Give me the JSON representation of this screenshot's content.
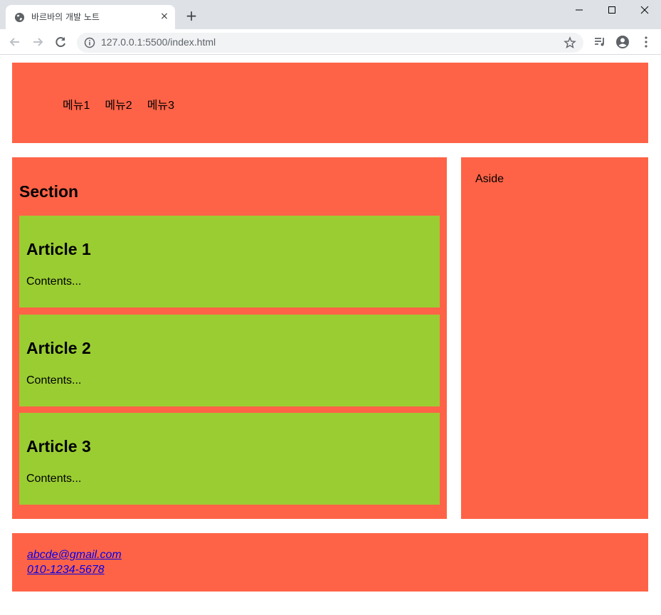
{
  "browser": {
    "tab_title": "바르바의 개발 노트",
    "tab_close": "×",
    "new_tab": "+",
    "url": "127.0.0.1:5500/index.html"
  },
  "header": {
    "menu": [
      "메뉴1",
      "메뉴2",
      "메뉴3"
    ]
  },
  "section": {
    "title": "Section",
    "articles": [
      {
        "title": "Article 1",
        "body": "Contents..."
      },
      {
        "title": "Article 2",
        "body": "Contents..."
      },
      {
        "title": "Article 3",
        "body": "Contents..."
      }
    ]
  },
  "aside": {
    "label": "Aside"
  },
  "footer": {
    "email": "abcde@gmail.com",
    "phone": "010-1234-5678"
  },
  "colors": {
    "block": "#ff6347",
    "article": "#9acd32",
    "link": "#0000ee"
  },
  "icons": [
    "globe-icon",
    "close-icon",
    "plus-icon",
    "minimize-icon",
    "maximize-icon",
    "back-icon",
    "forward-icon",
    "reload-icon",
    "info-icon",
    "star-icon",
    "media-icon",
    "account-icon",
    "more-icon"
  ]
}
